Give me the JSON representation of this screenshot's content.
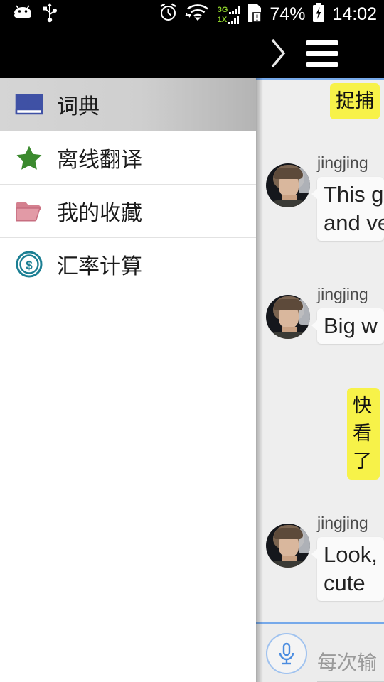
{
  "statusbar": {
    "icons_left": [
      "android-icon",
      "usb-icon"
    ],
    "icons_right": [
      "alarm-icon",
      "wifi-icon",
      "signal-icon",
      "sim-alert-icon",
      "battery-charging-icon"
    ],
    "signal_3g_label": "3G",
    "signal_1x_label": "1X",
    "battery_percent": "74%",
    "clock": "14:02"
  },
  "actionbar": {
    "forward_icon": "chevron-right-icon",
    "menu_icon": "hamburger-menu-icon"
  },
  "drawer": {
    "items": [
      {
        "label": "词典",
        "icon": "open-book-icon",
        "icon_color": "#3f51a5",
        "selected": true
      },
      {
        "label": "离线翻译",
        "icon": "star-icon",
        "icon_color": "#3b8a2e",
        "selected": false
      },
      {
        "label": "我的收藏",
        "icon": "folder-icon",
        "icon_color": "#d4808f",
        "selected": false
      },
      {
        "label": "汇率计算",
        "icon": "dollar-coin-icon",
        "icon_color": "#1b7f93",
        "selected": false
      }
    ]
  },
  "chat": {
    "accent_color": "#76a9ea",
    "messages": [
      {
        "side": "right",
        "type": "yellow",
        "text": "捉捕"
      },
      {
        "side": "left",
        "type": "white",
        "sender": "jingjing",
        "avatar": "user-avatar",
        "line1": "This g",
        "line2": "and ve"
      },
      {
        "side": "left",
        "type": "white",
        "sender": "jingjing",
        "avatar": "user-avatar",
        "line1": "Big w",
        "line2": ""
      },
      {
        "side": "right",
        "type": "yellow",
        "text": "快看\n了"
      },
      {
        "side": "left",
        "type": "white",
        "sender": "jingjing",
        "avatar": "user-avatar",
        "line1": "Look,",
        "line2": "cute"
      }
    ],
    "input": {
      "mic_icon": "microphone-icon",
      "placeholder": "每次输"
    }
  }
}
